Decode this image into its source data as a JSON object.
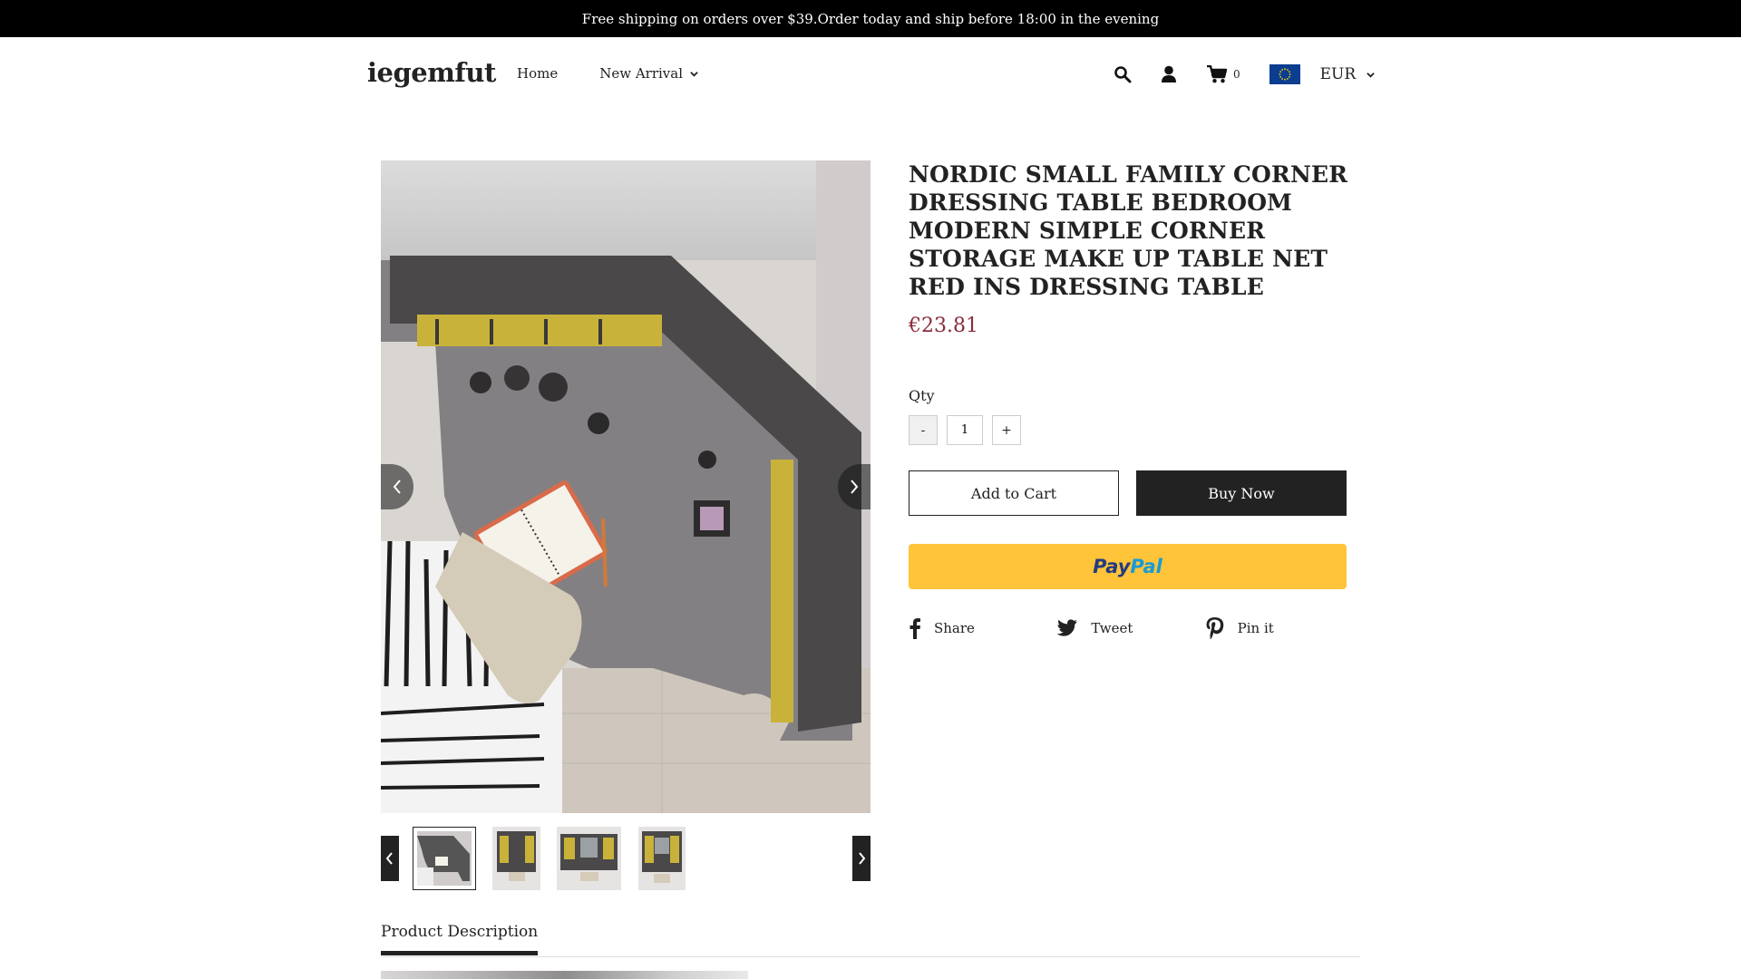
{
  "announcement": "Free shipping on orders over $39.Order today and ship before 18:00 in the evening",
  "header": {
    "logo": "iegemfut",
    "nav": [
      {
        "label": "Home"
      },
      {
        "label": "New Arrival",
        "has_dropdown": true
      }
    ],
    "icons": [
      "search-icon",
      "user-icon",
      "cart-icon"
    ],
    "cart_count": "0",
    "currency": "EUR",
    "currency_flag": "eu-flag"
  },
  "product": {
    "title": "NORDIC SMALL FAMILY CORNER DRESSING TABLE BEDROOM MODERN SIMPLE CORNER STORAGE MAKE UP TABLE NET RED INS DRESSING TABLE",
    "price": "€23.81",
    "qty_label": "Qty",
    "qty_minus": "-",
    "qty_value": "1",
    "qty_plus": "+",
    "add_to_cart": "Add to Cart",
    "buy_now": "Buy Now",
    "paypal": {
      "part1": "Pay",
      "part2": "Pal"
    },
    "share": [
      {
        "label": "Share",
        "icon": "facebook-icon"
      },
      {
        "label": "Tweet",
        "icon": "twitter-icon"
      },
      {
        "label": "Pin it",
        "icon": "pinterest-icon"
      }
    ]
  },
  "gallery": {
    "thumbnail_count": 4,
    "active_thumbnail": 1
  },
  "tabs": {
    "description": "Product Description"
  },
  "colors": {
    "price": "#8b2c3a",
    "paypal": "#ffc439",
    "dark": "#222222"
  }
}
